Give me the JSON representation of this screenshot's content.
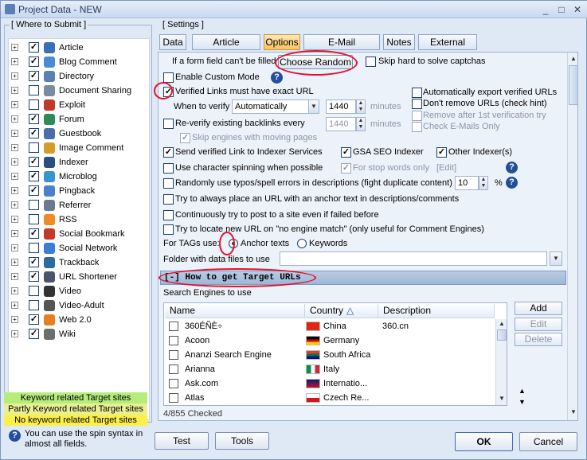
{
  "window": {
    "title": "Project Data - NEW",
    "controls": [
      "_",
      "□",
      "✕"
    ]
  },
  "where_to_submit": {
    "title": "[ Where to Submit ]",
    "items": [
      {
        "label": "Article",
        "checked": true,
        "icon": "article-icon",
        "color": "#3b6fb6"
      },
      {
        "label": "Blog Comment",
        "checked": true,
        "icon": "blog-comment-icon",
        "color": "#4a8bd6"
      },
      {
        "label": "Directory",
        "checked": true,
        "icon": "directory-icon",
        "color": "#5a7fb5"
      },
      {
        "label": "Document Sharing",
        "checked": false,
        "icon": "document-sharing-icon",
        "color": "#7a8aa0"
      },
      {
        "label": "Exploit",
        "checked": false,
        "icon": "exploit-icon",
        "color": "#c03a2b"
      },
      {
        "label": "Forum",
        "checked": true,
        "icon": "forum-icon",
        "color": "#2e8b57"
      },
      {
        "label": "Guestbook",
        "checked": true,
        "icon": "guestbook-icon",
        "color": "#4c6ea8"
      },
      {
        "label": "Image Comment",
        "checked": false,
        "icon": "image-comment-icon",
        "color": "#d49b2a"
      },
      {
        "label": "Indexer",
        "checked": true,
        "icon": "indexer-icon",
        "color": "#2a4f80"
      },
      {
        "label": "Microblog",
        "checked": true,
        "icon": "microblog-icon",
        "color": "#3a93d1"
      },
      {
        "label": "Pingback",
        "checked": true,
        "icon": "pingback-icon",
        "color": "#4d7fcc"
      },
      {
        "label": "Referrer",
        "checked": false,
        "icon": "referrer-icon",
        "color": "#6b7a8f"
      },
      {
        "label": "RSS",
        "checked": false,
        "icon": "rss-icon",
        "color": "#f08a24"
      },
      {
        "label": "Social Bookmark",
        "checked": true,
        "icon": "social-bookmark-icon",
        "color": "#c0392b"
      },
      {
        "label": "Social Network",
        "checked": false,
        "icon": "social-network-icon",
        "color": "#3b7dd8"
      },
      {
        "label": "Trackback",
        "checked": true,
        "icon": "trackback-icon",
        "color": "#2d6a9f"
      },
      {
        "label": "URL Shortener",
        "checked": true,
        "icon": "url-shortener-icon",
        "color": "#4a5568"
      },
      {
        "label": "Video",
        "checked": false,
        "icon": "video-icon",
        "color": "#333333"
      },
      {
        "label": "Video-Adult",
        "checked": false,
        "icon": "video-adult-icon",
        "color": "#555555"
      },
      {
        "label": "Web 2.0",
        "checked": true,
        "icon": "web20-icon",
        "color": "#e67e22"
      },
      {
        "label": "Wiki",
        "checked": true,
        "icon": "wiki-icon",
        "color": "#6d6d6d"
      }
    ],
    "legend": [
      {
        "label": "Keyword related Target sites",
        "color": "#b6ec7a"
      },
      {
        "label": "Partly Keyword related Target sites",
        "color": "#e9ef93"
      },
      {
        "label": "No keyword related Target sites",
        "color": "#fcef4c"
      }
    ],
    "spin_hint": "You can use the spin syntax in almost all fields."
  },
  "settings": {
    "title": "[ Settings ]",
    "tabs": [
      "Data",
      "Article Manager",
      "Options",
      "E-Mail verification",
      "Notes",
      "External APIs"
    ],
    "active_tab": "Options",
    "form_field_label": "If a form field can't be filled",
    "form_field_value": "Choose Random",
    "skip_captcha": "Skip hard to solve captchas",
    "custom_mode": "Enable Custom Mode",
    "verified_exact": "Verified Links must have exact URL",
    "when_verify_label": "When to verify",
    "when_verify_value": "Automatically",
    "verify_minutes": "1440",
    "minutes_unit": "minutes",
    "auto_export": "Automatically export verified URLs",
    "dont_remove": "Don't remove URLs (check hint)",
    "remove_after_first": "Remove after 1st verification try",
    "check_emails": "Check E-Mails Only",
    "reverify_label": "Re-verify existing backlinks every",
    "reverify_minutes": "1440",
    "skip_moving_pages": "Skip engines with moving pages",
    "send_indexer": "Send verified Link to Indexer Services",
    "gsa_indexer": "GSA SEO Indexer",
    "other_indexers": "Other Indexer(s)",
    "char_spinning": "Use character spinning when possible",
    "stop_words": "For stop words only",
    "edit_link": "[Edit]",
    "typos": "Randomly use typos/spell errors in descriptions (fight duplicate content)",
    "typos_percent": "10",
    "percent_unit": "%",
    "anchor_place": "Try to always place an URL with an anchor text in descriptions/comments",
    "continuously_post": "Continuously try to post to a site even if failed before",
    "locate_new_url": "Try to locate new URL on \"no engine match\" (only useful for Comment Engines)",
    "tags_label": "For TAGs use:",
    "anchor_texts": "Anchor texts",
    "keywords": "Keywords",
    "folder_label": "Folder with  data files to use",
    "folder_value": "",
    "target_header": "[-] How to get Target URLs",
    "search_engines_label": "Search Engines to use",
    "columns": [
      "Name",
      "Country",
      "Description"
    ],
    "sort_indicator": "△",
    "engines": [
      {
        "name": "360ÉÑÈ÷",
        "country": "China",
        "description": "360.cn",
        "flag": "china"
      },
      {
        "name": "Acoon",
        "country": "Germany",
        "description": "",
        "flag": "germany"
      },
      {
        "name": "Ananzi Search Engine",
        "country": "South Africa",
        "description": "",
        "flag": "south-africa"
      },
      {
        "name": "Arianna",
        "country": "Italy",
        "description": "",
        "flag": "italy"
      },
      {
        "name": "Ask.com",
        "country": "Internatio...",
        "description": "",
        "flag": "uk"
      },
      {
        "name": "Atlas",
        "country": "Czech Re...",
        "description": "",
        "flag": "czech"
      }
    ],
    "add_button": "Add",
    "edit_button": "Edit",
    "delete_button": "Delete",
    "checked_count": "4/855 Checked"
  },
  "footer": {
    "test": "Test",
    "tools": "Tools",
    "ok": "OK",
    "cancel": "Cancel"
  },
  "accent_color": "#e4102a"
}
